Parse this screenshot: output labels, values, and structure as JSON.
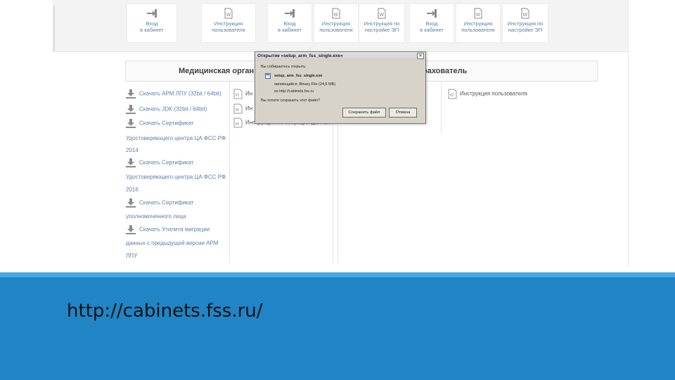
{
  "top_tiles": [
    {
      "label": "Вход\nв кабинет",
      "icon": "login-icon"
    },
    {
      "label": "Инструкция\nпользователя",
      "icon": "word-doc-icon"
    },
    {
      "label": "Вход\nв кабинет",
      "icon": "login-icon"
    },
    {
      "label": "Инструкция\nпользователя",
      "icon": "word-doc-icon"
    },
    {
      "label": "Инструкция по\nнастройке ЭП",
      "icon": "word-doc-icon"
    },
    {
      "label": "Вход\nв кабинет",
      "icon": "login-icon"
    },
    {
      "label": "Инструкция\nпользователя",
      "icon": "word-doc-icon"
    },
    {
      "label": "Инструкция по\nнастройке ЭП",
      "icon": "word-doc-icon"
    }
  ],
  "panels": {
    "medical_title": "Медицинская орган",
    "insurer_title": "рахователь"
  },
  "downloads": [
    {
      "label": "Скачать АРМ ЛПУ (32bit / 64bit)",
      "continuation": [
        "Удостоверяющего центра ЦА ФСС РФ"
      ]
    },
    {
      "label": "Скачать JDK (32bit / 64bit)",
      "continuation": []
    },
    {
      "label": "Скачать Сертификат",
      "continuation": [
        "Удостоверяющего центра ЦА ФСС РФ",
        "2014"
      ]
    },
    {
      "label": "Скачать Сертификат",
      "continuation": [
        "Удостоверяющего центра ЦА ФСС РФ",
        "2016"
      ]
    },
    {
      "label": "Скачать Сертификат",
      "continuation": [
        "уполномоченного лица"
      ]
    },
    {
      "label": "Скачать Утилита миграции",
      "continuation": [
        "данных с предыдущей версии АРМ",
        "ЛПУ"
      ]
    }
  ],
  "docs_medical": [
    {
      "label": "Ин"
    },
    {
      "label": "Ин"
    },
    {
      "label": "Инструкция по миграции данных"
    }
  ],
  "docs_insurer": [
    {
      "label": "Инструкция пользователя"
    }
  ],
  "dialog": {
    "title": "Открытие «setup_arm_fss_single.exe»",
    "intro": "Вы собираетесь открыть:",
    "filename": "setup_arm_fss_single.exe",
    "type_line": "являющийся: Binary File (24,6 МБ)",
    "from_line": "из http://cabinets.fss.ru",
    "question": "Вы хотите сохранить этот файл?",
    "save_label": "Сохранить файл",
    "cancel_label": "Отмена",
    "close_glyph": "×"
  },
  "banner": {
    "url": "http://cabinets.fss.ru/"
  }
}
